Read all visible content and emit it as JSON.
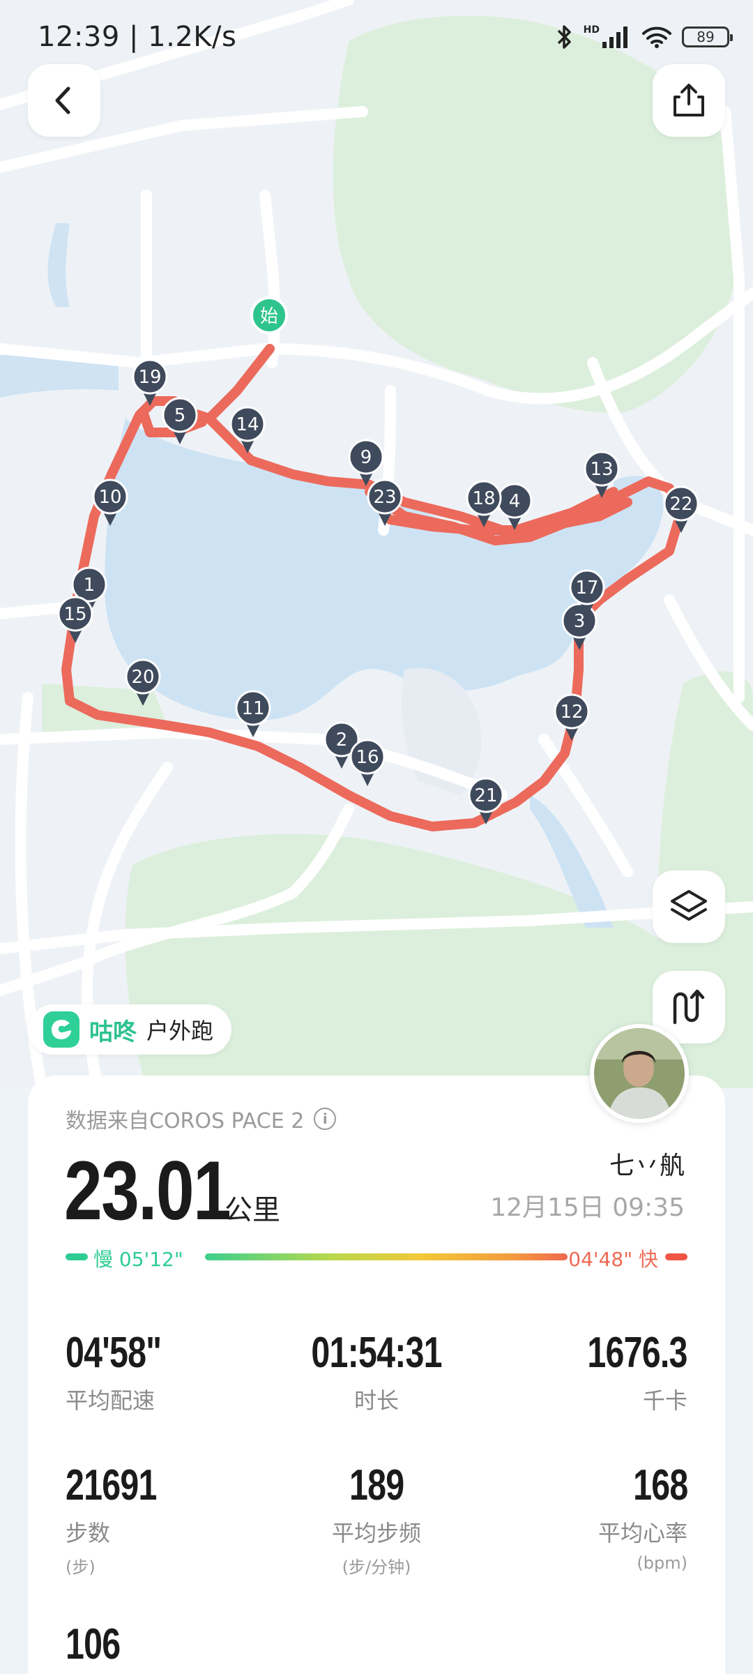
{
  "status_bar": {
    "time": "12:39 | 1.2K/s",
    "network_tag": "HD",
    "battery": "89"
  },
  "map": {
    "start_marker": "始",
    "km_markers": [
      "19",
      "5",
      "14",
      "10",
      "1",
      "15",
      "20",
      "11",
      "2",
      "16",
      "21",
      "12",
      "3",
      "17",
      "22",
      "13",
      "4",
      "18",
      "9",
      "23"
    ],
    "route_color": "#ec6a5c"
  },
  "app": {
    "name": "咕咚",
    "activity_type": "户外跑"
  },
  "summary": {
    "source": "数据来自COROS PACE 2",
    "distance": "23.01",
    "distance_unit": "公里",
    "user_name": "七丷舧",
    "date": "12月15日 09:35",
    "pace_slow": "慢 05'12\"",
    "pace_fast": "04'48\" 快"
  },
  "stats": [
    {
      "value": "04'58\"",
      "label": "平均配速",
      "unit": ""
    },
    {
      "value": "01:54:31",
      "label": "时长",
      "unit": ""
    },
    {
      "value": "1676.3",
      "label": "千卡",
      "unit": ""
    },
    {
      "value": "21691",
      "label": "步数",
      "unit": "(步)"
    },
    {
      "value": "189",
      "label": "平均步频",
      "unit": "(步/分钟)"
    },
    {
      "value": "168",
      "label": "平均心率",
      "unit": "(bpm)"
    },
    {
      "value": "106",
      "label": "",
      "unit": ""
    }
  ],
  "icons": {
    "back": "chevron-left-icon",
    "share": "share-icon",
    "layers": "layers-icon",
    "route": "route-icon",
    "info": "info-icon",
    "bluetooth": "bluetooth-icon",
    "signal": "signal-icon",
    "wifi": "wifi-icon"
  }
}
